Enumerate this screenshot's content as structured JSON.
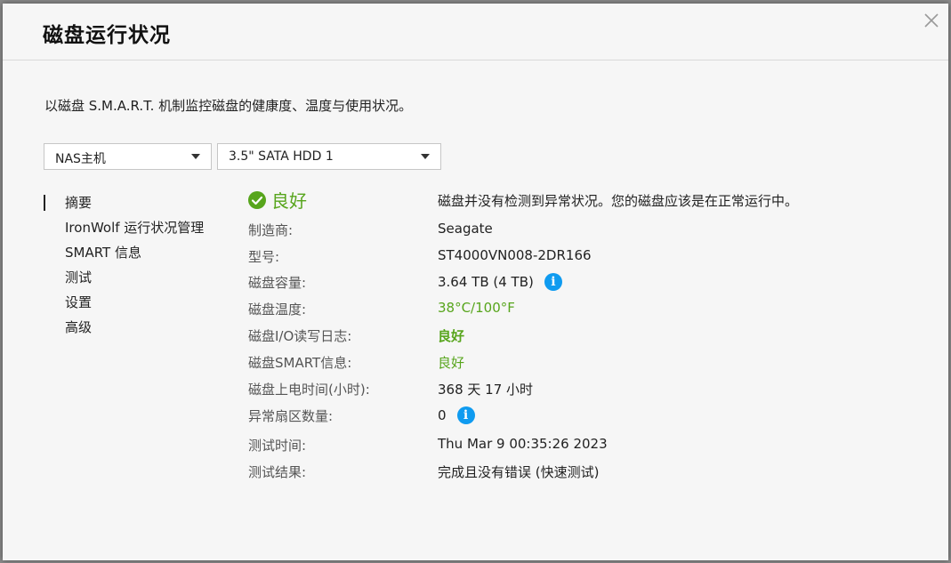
{
  "dialog": {
    "title": "磁盘运行状况",
    "description": "以磁盘 S.M.A.R.T. 机制监控磁盘的健康度、温度与使用状况。"
  },
  "selectors": {
    "host": "NAS主机",
    "disk": "3.5\" SATA HDD 1"
  },
  "nav": {
    "items": [
      {
        "label": "摘要",
        "active": true
      },
      {
        "label": "IronWolf 运行状况管理"
      },
      {
        "label": "SMART 信息"
      },
      {
        "label": "测试"
      },
      {
        "label": "设置"
      },
      {
        "label": "高级"
      }
    ]
  },
  "summary": {
    "status": "良好",
    "status_message": "磁盘并没有检测到异常状况。您的磁盘应该是在正常运行中。",
    "fields": [
      {
        "label": "制造商:",
        "value": "Seagate"
      },
      {
        "label": "型号:",
        "value": "ST4000VN008-2DR166"
      },
      {
        "label": "磁盘容量:",
        "value": "3.64 TB (4 TB)"
      },
      {
        "label": "磁盘温度:",
        "value": "38°C/100°F"
      },
      {
        "label": "磁盘I/O读写日志:",
        "value": "良好"
      },
      {
        "label": "磁盘SMART信息:",
        "value": "良好"
      },
      {
        "label": "磁盘上电时间(小时):",
        "value": "368 天 17 小时"
      },
      {
        "label": "异常扇区数量:",
        "value": "0"
      },
      {
        "label": "测试时间:",
        "value": "Thu Mar 9 00:35:26 2023"
      },
      {
        "label": "测试结果:",
        "value": "完成且没有错误 (快速测试)"
      }
    ]
  },
  "icons": {
    "close": "close-icon",
    "status": "check-circle-icon",
    "info": "info-icon",
    "dropdown": "chevron-down-icon"
  },
  "colors": {
    "good": "#57a51c",
    "info": "#0f9bf0"
  }
}
